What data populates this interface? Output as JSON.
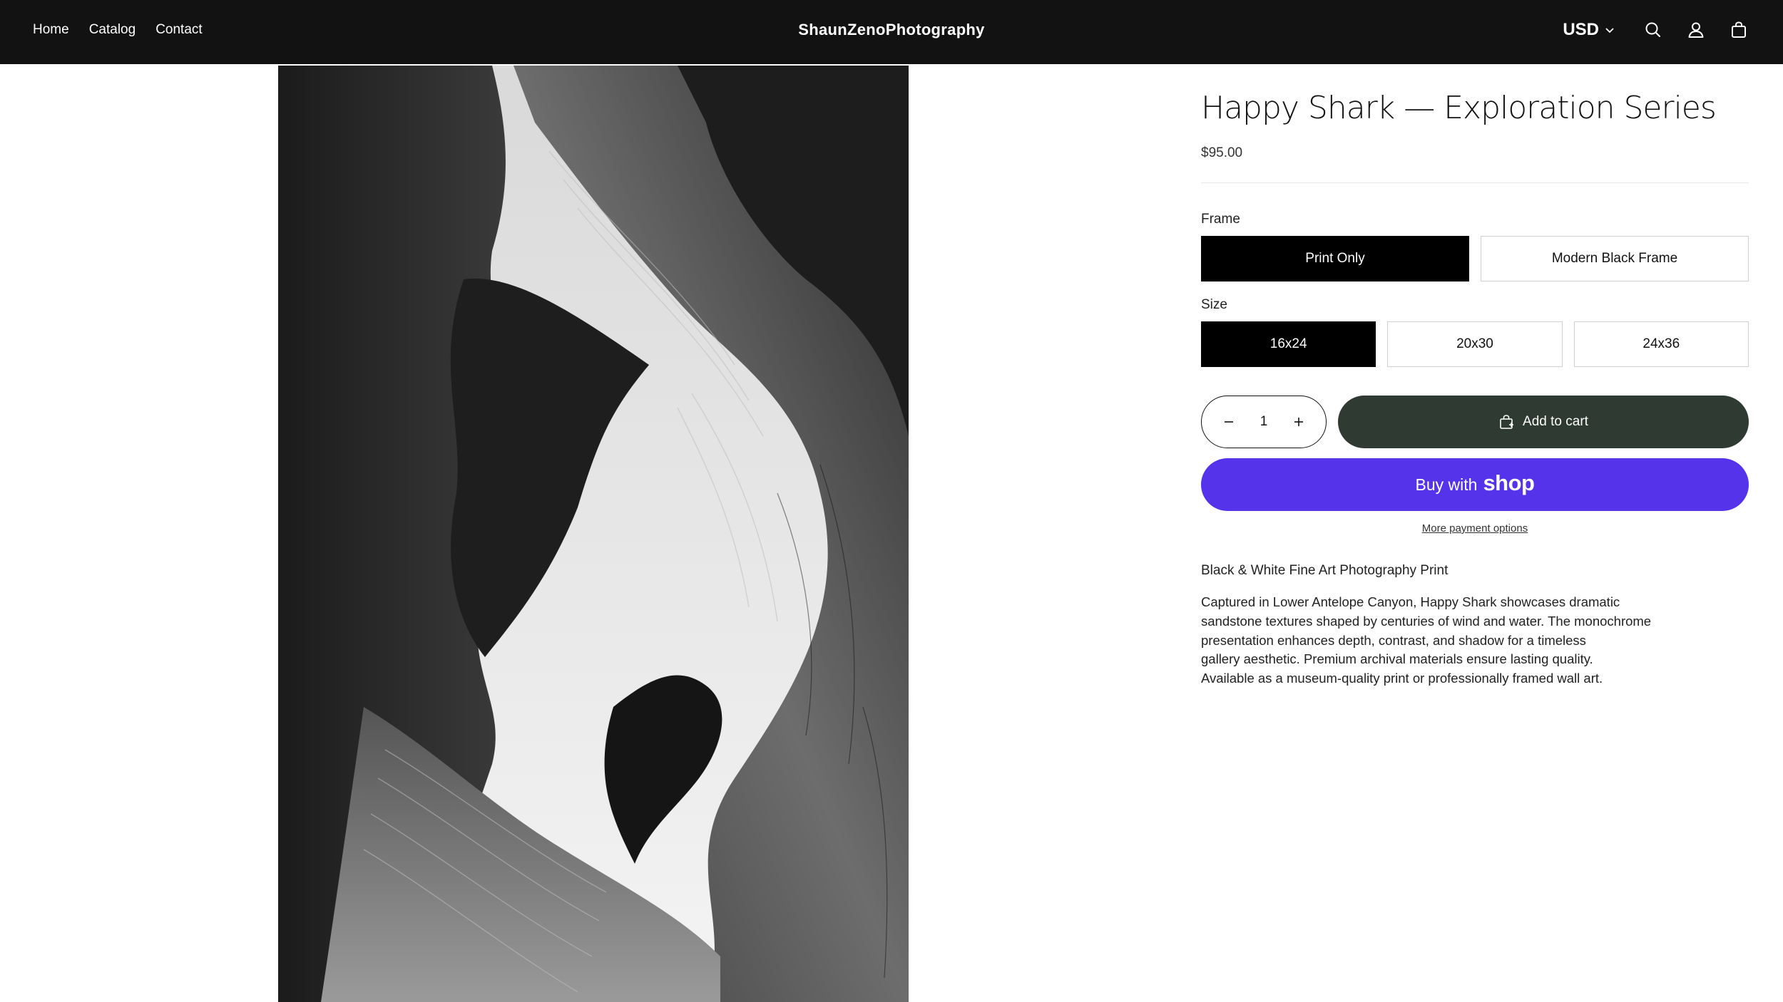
{
  "header": {
    "nav": [
      {
        "label": "Home"
      },
      {
        "label": "Catalog"
      },
      {
        "label": "Contact"
      }
    ],
    "brand": "ShaunZenoPhotography",
    "currency": "USD",
    "icons": [
      "search-icon",
      "account-icon",
      "cart-icon"
    ]
  },
  "product": {
    "image_alt": "Black and white photo of Lower Antelope Canyon sandstone",
    "title": "Happy Shark — Exploration Series",
    "price": "$95.00",
    "frame": {
      "label": "Frame",
      "options": [
        "Print Only",
        "Modern Black Frame"
      ],
      "selected": "Print Only"
    },
    "size": {
      "label": "Size",
      "options": [
        "16x24",
        "20x30",
        "24x36"
      ],
      "selected": "16x24"
    },
    "quantity": "1",
    "add_to_cart": "Add to cart",
    "buy_with": "Buy with",
    "shop_logo": "shop",
    "more_payment": "More payment options",
    "description_title": "Black & White Fine Art Photography Print",
    "description_lines": [
      "Captured in Lower Antelope Canyon, Happy Shark showcases dramatic",
      "sandstone textures shaped by centuries of wind and water. The monochrome",
      "presentation enhances depth, contrast, and shadow for a timeless",
      "gallery aesthetic. Premium archival materials ensure lasting quality.",
      "Available as a museum-quality print or professionally framed wall art."
    ]
  },
  "colors": {
    "header_bg": "#121212",
    "selected_option": "#000000",
    "add_to_cart_bg": "#2f3a33",
    "shop_pay_bg": "#5433eb"
  }
}
